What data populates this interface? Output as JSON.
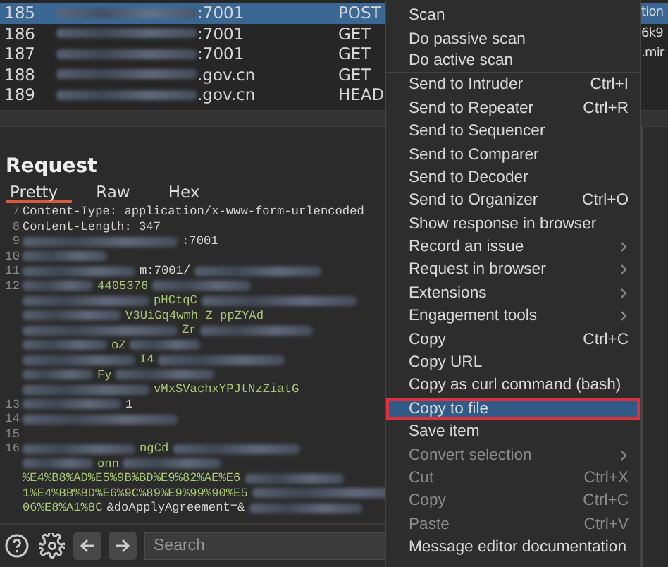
{
  "history": [
    {
      "number": "185",
      "host": ":7001",
      "method": "POST",
      "column_4": "tion",
      "selected": true
    },
    {
      "number": "186",
      "host": ":7001",
      "method": "GET",
      "column_4": "6k9",
      "selected": false
    },
    {
      "number": "187",
      "host": ":7001",
      "method": "GET",
      "column_4": ".mir",
      "selected": false
    },
    {
      "number": "188",
      "host": ".gov.cn",
      "method": "GET",
      "selected": false
    },
    {
      "number": "189",
      "host": ".gov.cn",
      "method": "HEAD",
      "selected": false
    }
  ],
  "request": {
    "title": "Request",
    "tabs": [
      {
        "label": "Pretty",
        "selected": true
      },
      {
        "label": "Raw",
        "selected": false
      },
      {
        "label": "Hex",
        "selected": false
      }
    ],
    "lines": [
      {
        "number": "7",
        "parts": [
          {
            "kind": "text",
            "text": "Content-Type: application/x-www-form-urlencoded"
          }
        ]
      },
      {
        "number": "8",
        "parts": [
          {
            "kind": "text",
            "text": "Content-Length: 347"
          }
        ]
      },
      {
        "number": "9",
        "parts": [
          {
            "kind": "redacted"
          },
          {
            "kind": "text",
            "text": ":7001"
          }
        ]
      },
      {
        "number": "10",
        "parts": [
          {
            "kind": "redacted"
          }
        ]
      },
      {
        "number": "11",
        "parts": [
          {
            "kind": "redacted"
          },
          {
            "kind": "text",
            "text": "m:7001/"
          },
          {
            "kind": "redacted"
          }
        ]
      },
      {
        "number": "12",
        "parts": [
          {
            "kind": "redacted"
          },
          {
            "kind": "value",
            "text": "4405376"
          },
          {
            "kind": "redacted"
          }
        ]
      },
      {
        "parts": [
          {
            "kind": "redacted"
          },
          {
            "kind": "value",
            "text": "pHCtqC"
          },
          {
            "kind": "redacted"
          }
        ]
      },
      {
        "parts": [
          {
            "kind": "redacted"
          },
          {
            "kind": "value",
            "text": "V3UiGq4wmh Z ppZYAd"
          }
        ]
      },
      {
        "parts": [
          {
            "kind": "redacted"
          },
          {
            "kind": "value",
            "text": "Zr"
          },
          {
            "kind": "redacted"
          }
        ]
      },
      {
        "parts": [
          {
            "kind": "redacted"
          },
          {
            "kind": "value",
            "text": "oZ"
          },
          {
            "kind": "redacted"
          }
        ]
      },
      {
        "parts": [
          {
            "kind": "redacted"
          },
          {
            "kind": "value",
            "text": "I4"
          },
          {
            "kind": "redacted"
          }
        ]
      },
      {
        "parts": [
          {
            "kind": "redacted"
          },
          {
            "kind": "value",
            "text": "Fy"
          },
          {
            "kind": "redacted"
          }
        ]
      },
      {
        "parts": [
          {
            "kind": "redacted"
          },
          {
            "kind": "value",
            "text": "vMxSVachxYPJtNzZiatG"
          }
        ]
      },
      {
        "number": "13",
        "parts": [
          {
            "kind": "redacted"
          },
          {
            "kind": "text",
            "text": "1"
          }
        ]
      },
      {
        "number": "14",
        "parts": [
          {
            "kind": "redacted"
          }
        ]
      },
      {
        "number": "15"
      },
      {
        "number": "16",
        "parts": [
          {
            "kind": "redacted"
          },
          {
            "kind": "value",
            "text": "ngCd"
          },
          {
            "kind": "redacted"
          }
        ]
      },
      {
        "parts": [
          {
            "kind": "redacted"
          },
          {
            "kind": "value",
            "text": "onn"
          },
          {
            "kind": "redacted"
          }
        ]
      },
      {
        "parts": [
          {
            "kind": "value",
            "text": "%E4%B8%AD%E5%9B%BD%E9%82%AE%E6"
          },
          {
            "kind": "redacted"
          }
        ]
      },
      {
        "parts": [
          {
            "kind": "value",
            "text": "1%E4%BB%BD%E6%9C%89%E9%99%90%E5"
          },
          {
            "kind": "redacted"
          }
        ]
      },
      {
        "parts": [
          {
            "kind": "value",
            "text": "06%E8%A1%8C"
          },
          {
            "kind": "text",
            "text": "&doApplyAgreement=&"
          },
          {
            "kind": "redacted"
          }
        ]
      }
    ]
  },
  "search": {
    "placeholder": "Search"
  },
  "menu": [
    {
      "label": "Scan",
      "selected": false,
      "disabled": false
    },
    {
      "label": "Do passive scan",
      "selected": false,
      "disabled": false
    },
    {
      "label": "Do active scan",
      "selected": false,
      "disabled": false,
      "separator_after": true
    },
    {
      "label": "Send to Intruder",
      "shortcut": "Ctrl+I",
      "selected": false,
      "disabled": false
    },
    {
      "label": "Send to Repeater",
      "shortcut": "Ctrl+R",
      "selected": false,
      "disabled": false
    },
    {
      "label": "Send to Sequencer",
      "selected": false,
      "disabled": false
    },
    {
      "label": "Send to Comparer",
      "selected": false,
      "disabled": false
    },
    {
      "label": "Send to Decoder",
      "selected": false,
      "disabled": false
    },
    {
      "label": "Send to Organizer",
      "shortcut": "Ctrl+O",
      "selected": false,
      "disabled": false
    },
    {
      "label": "Show response in browser",
      "selected": false,
      "disabled": false
    },
    {
      "label": "Record an issue",
      "submenu": true,
      "selected": false,
      "disabled": false
    },
    {
      "label": "Request in browser",
      "submenu": true,
      "selected": false,
      "disabled": false
    },
    {
      "label": "Extensions",
      "submenu": true,
      "selected": false,
      "disabled": false
    },
    {
      "label": "Engagement tools",
      "submenu": true,
      "selected": false,
      "disabled": false
    },
    {
      "label": "Copy",
      "shortcut": "Ctrl+C",
      "selected": false,
      "disabled": false
    },
    {
      "label": "Copy URL",
      "selected": false,
      "disabled": false
    },
    {
      "label": "Copy as curl command (bash)",
      "selected": false,
      "disabled": false
    },
    {
      "label": "Copy to file",
      "selected": true,
      "disabled": false
    },
    {
      "label": "Save item",
      "selected": false,
      "disabled": false
    },
    {
      "label": "Convert selection",
      "submenu": true,
      "selected": false,
      "disabled": true
    },
    {
      "label": "Cut",
      "shortcut": "Ctrl+X",
      "selected": false,
      "disabled": true
    },
    {
      "label": "Copy",
      "shortcut": "Ctrl+C",
      "selected": false,
      "disabled": true
    },
    {
      "label": "Paste",
      "shortcut": "Ctrl+V",
      "selected": false,
      "disabled": true
    },
    {
      "label": "Message editor documentation",
      "selected": false,
      "disabled": false
    }
  ]
}
